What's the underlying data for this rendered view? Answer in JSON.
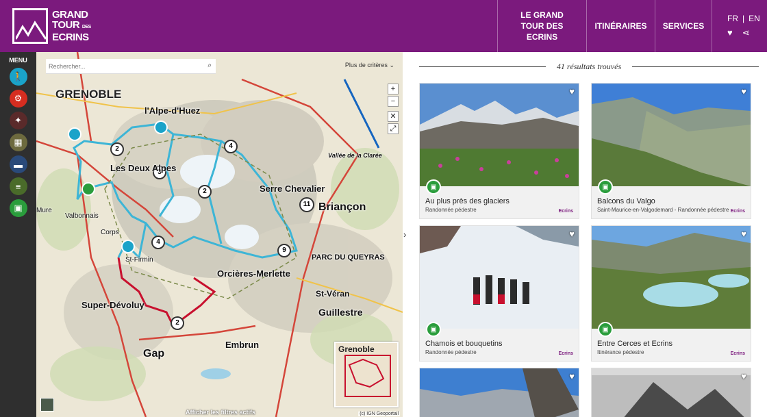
{
  "header": {
    "logo_line1": "GRAND",
    "logo_line2": "TOUR",
    "logo_line2_small": "DES",
    "logo_line3": "ECRINS",
    "nav": [
      {
        "label": "LE GRAND TOUR DES ECRINS"
      },
      {
        "label": "ITINÉRAIRES"
      },
      {
        "label": "SERVICES"
      }
    ],
    "lang_fr": "FR",
    "lang_sep": "|",
    "lang_en": "EN",
    "heart_icon": "heart-icon",
    "share_icon": "share-icon"
  },
  "sidemenu": {
    "label": "MENU",
    "items": [
      {
        "icon": "hiking-icon",
        "color": "#1aa3c9"
      },
      {
        "icon": "cycling-icon",
        "color": "#d62d20"
      },
      {
        "icon": "walking-icon",
        "color": "#5a2a2a"
      },
      {
        "icon": "map-icon",
        "color": "#6d6a3e"
      },
      {
        "icon": "bed-icon",
        "color": "#2a4a7a"
      },
      {
        "icon": "list-icon",
        "color": "#4a6b2a"
      },
      {
        "icon": "suitcase-icon",
        "color": "#2a9d3c"
      }
    ]
  },
  "map": {
    "search_placeholder": "Rechercher...",
    "criteria": "Plus de critères",
    "zoom_in": "+",
    "zoom_out": "−",
    "filters": "Afficher les filtres actifs",
    "minimap_label": "Grenoble",
    "copyright": "(c) IGN Geoportail",
    "labels": [
      "GRENOBLE",
      "l'Alpe-d'Huez",
      "Les Deux Alpes",
      "Briançon",
      "Serre Chevalier",
      "Orcières-Merlette",
      "Super-Dévoluy",
      "Gap",
      "Embrun",
      "Guillestre",
      "St-Véran",
      "Valbonnais",
      "Vallée de la Clarée",
      "PARC DU QUEYRAS",
      "St-Firmin",
      "Mure",
      "Corps"
    ],
    "stage_markers": [
      "2",
      "3",
      "4",
      "2",
      "4",
      "11",
      "9",
      "2"
    ]
  },
  "toggle": "›",
  "results": {
    "count_text": "41 résultats trouvés",
    "cards": [
      {
        "title": "Au plus près des glaciers",
        "sub": "Randonnée pédestre",
        "park": "Ecrins"
      },
      {
        "title": "Balcons du Valgo",
        "sub": "Saint-Maurice-en-Valgodemard  -  Randonnée pédestre",
        "park": "Ecrins"
      },
      {
        "title": "Chamois et bouquetins",
        "sub": "Randonnée pédestre",
        "park": "Ecrins"
      },
      {
        "title": "Entre Cerces et Ecrins",
        "sub": "Itinérance pédestre",
        "park": "Ecrins"
      },
      {
        "title": "",
        "sub": "",
        "park": ""
      },
      {
        "title": "",
        "sub": "",
        "park": ""
      }
    ]
  },
  "colors": {
    "brand": "#7b1a7d",
    "route": "#3db5d6",
    "route_red": "#c8102e",
    "badge": "#2a9d3c"
  }
}
